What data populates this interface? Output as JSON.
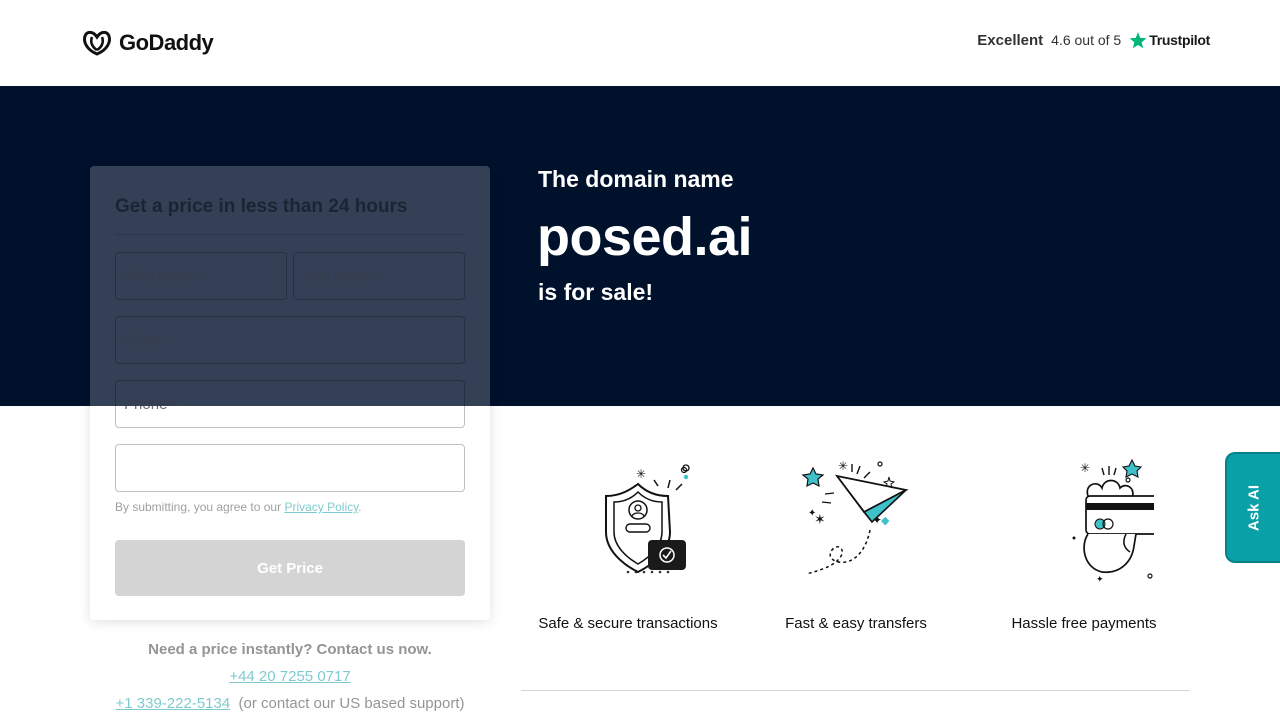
{
  "header": {
    "logo_text": "GoDaddy",
    "trust_rating": "Excellent",
    "trust_score": "4.6 out of 5",
    "trust_brand": "Trustpilot"
  },
  "hero": {
    "pre": "The domain name",
    "domain": "posed.ai",
    "post": "is for sale!"
  },
  "form": {
    "title": "Get a price in less than 24 hours",
    "first_name_placeholder": "First Name *",
    "last_name_placeholder": "Last Name *",
    "email_placeholder": "Email *",
    "phone_placeholder": "Phone *",
    "consent_text": "By submitting, you agree to our ",
    "privacy_link": "Privacy Policy",
    "consent_end": ".",
    "submit_label": "Get Price"
  },
  "contact": {
    "question": "Need a price instantly? Contact us now.",
    "uk_phone": "+44 20 7255 0717",
    "us_phone": "+1 339-222-5134",
    "us_note": "(or contact our US based support)"
  },
  "features": [
    {
      "label": "Safe & secure transactions",
      "icon": "shield-icon"
    },
    {
      "label": "Fast & easy transfers",
      "icon": "paper-plane-icon"
    },
    {
      "label": "Hassle free payments",
      "icon": "credit-card-icon"
    }
  ],
  "ask_ai": {
    "label": "Ask AI"
  },
  "colors": {
    "hero_bg": "#00112c",
    "accent": "#09a0a8",
    "trustpilot_green": "#00b67a"
  }
}
